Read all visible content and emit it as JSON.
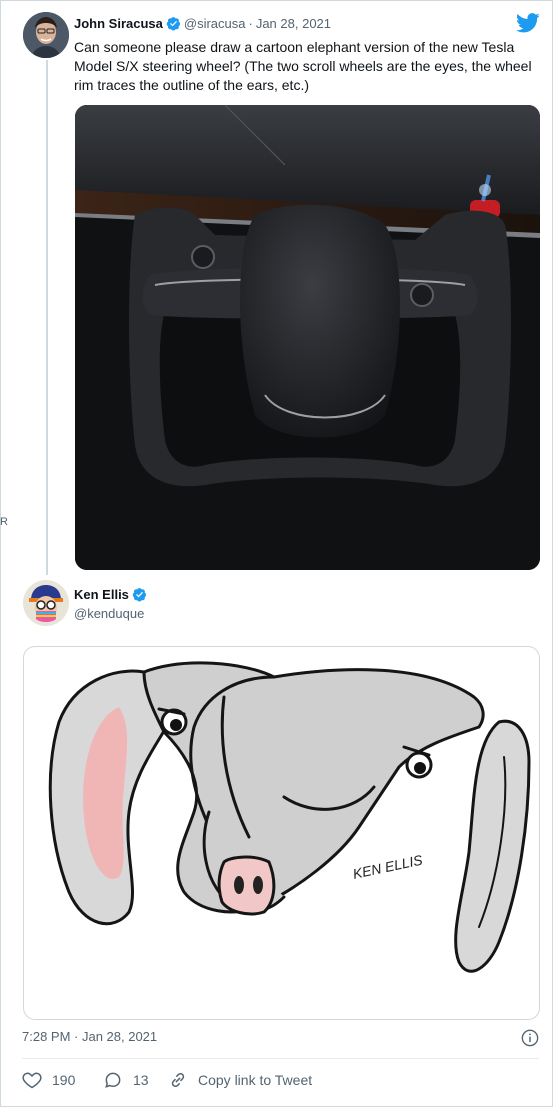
{
  "quoted_tweet": {
    "author_name": "John Siracusa",
    "handle": "@siracusa",
    "separator": "·",
    "date": "Jan 28, 2021",
    "text": "Can someone please draw a cartoon elephant version of the new Tesla Model S/X steering wheel? (The two scroll wheels are the eyes, the wheel rim traces the outline of the ears, etc.)",
    "media_description": "Tesla yoke steering wheel photo"
  },
  "reply_tweet": {
    "author_name": "Ken Ellis",
    "handle": "@kenduque",
    "drawing_signature": "KEN ELLIS",
    "timestamp": "7:28 PM · Jan 28, 2021"
  },
  "actions": {
    "like_count": "190",
    "reply_count": "13",
    "copy_link_label": "Copy link to Tweet"
  },
  "side_mark": "R",
  "colors": {
    "twitter_blue": "#1d9bf0",
    "text_primary": "#0f1419",
    "text_secondary": "#536471",
    "border": "#cfd9de"
  },
  "icons": {
    "twitter_logo": "twitter-bird-icon",
    "verified": "verified-badge-icon",
    "info": "info-icon",
    "like": "heart-icon",
    "reply": "reply-bubble-icon",
    "copy_link": "link-icon"
  }
}
